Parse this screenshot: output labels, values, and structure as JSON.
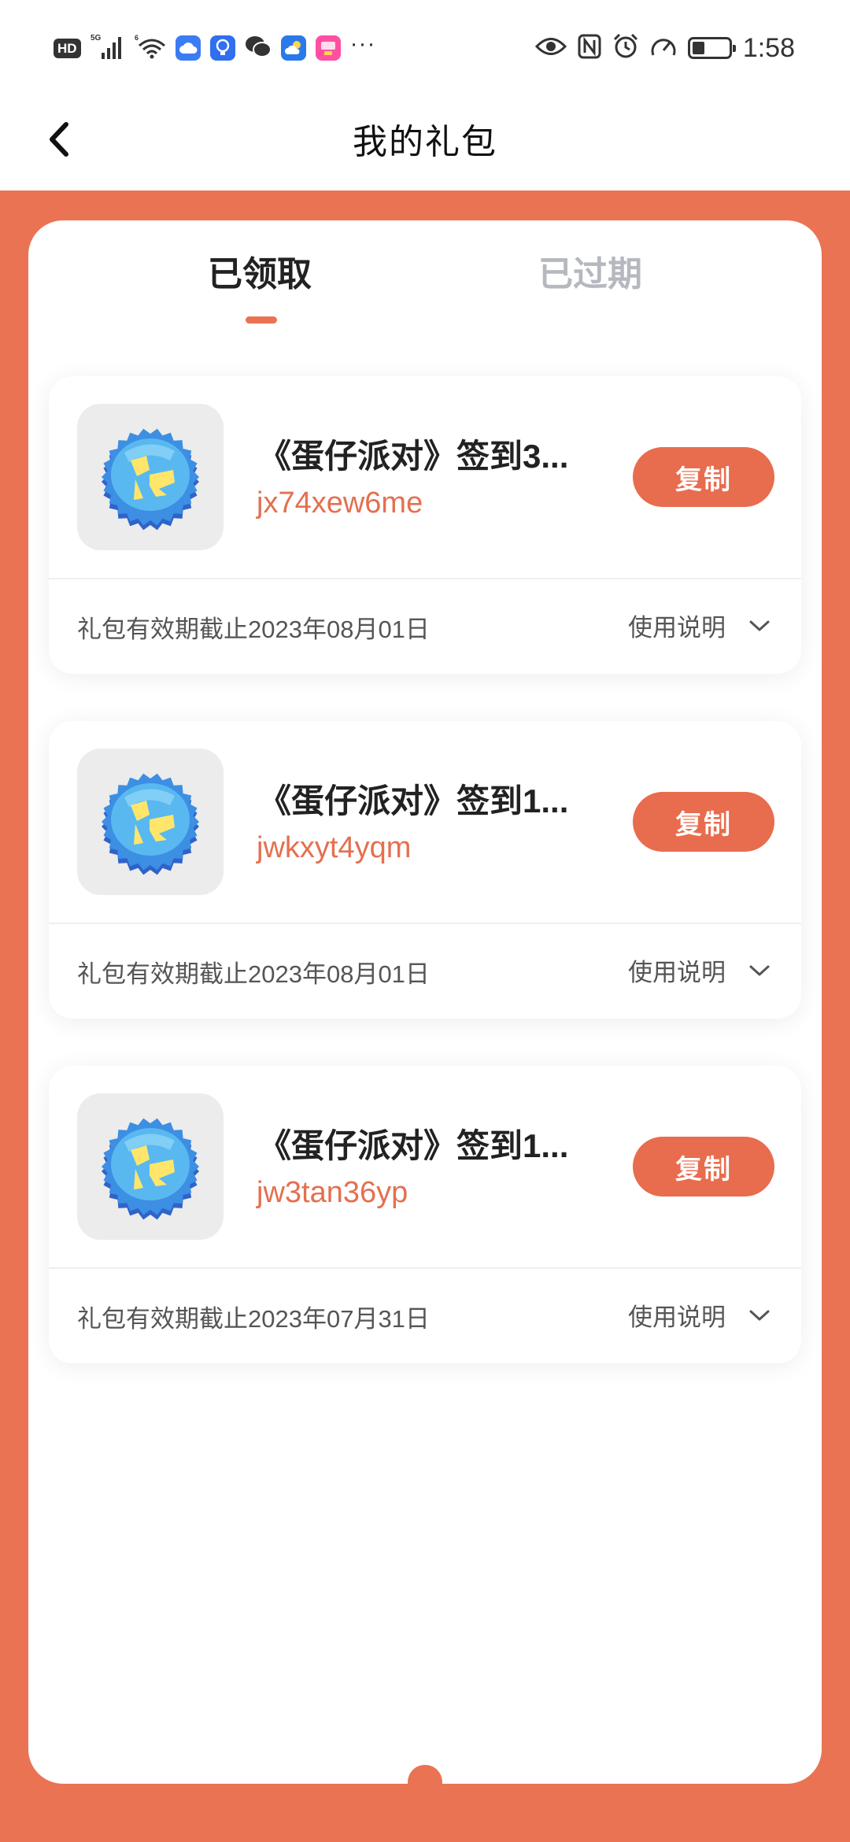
{
  "status_bar": {
    "time": "1:58",
    "hd": "HD",
    "network": "5G",
    "more": "···",
    "battery_level": 0.35
  },
  "header": {
    "title": "我的礼包"
  },
  "tabs": {
    "active": "已领取",
    "inactive": "已过期"
  },
  "gifts": [
    {
      "title": "《蛋仔派对》签到3...",
      "code": "jx74xew6me",
      "copy_label": "复制",
      "validity": "礼包有效期截止2023年08月01日",
      "usage_label": "使用说明"
    },
    {
      "title": "《蛋仔派对》签到1...",
      "code": "jwkxyt4yqm",
      "copy_label": "复制",
      "validity": "礼包有效期截止2023年08月01日",
      "usage_label": "使用说明"
    },
    {
      "title": "《蛋仔派对》签到1...",
      "code": "jw3tan36yp",
      "copy_label": "复制",
      "validity": "礼包有效期截止2023年07月31日",
      "usage_label": "使用说明"
    }
  ],
  "colors": {
    "accent": "#ea7354",
    "code_text": "#e4704f",
    "inactive_tab": "#b5b9bf"
  },
  "icons": {
    "back": "chevron-left-icon",
    "usage_toggle": "chevron-down-icon",
    "game": "bottle-cap-game-icon"
  }
}
